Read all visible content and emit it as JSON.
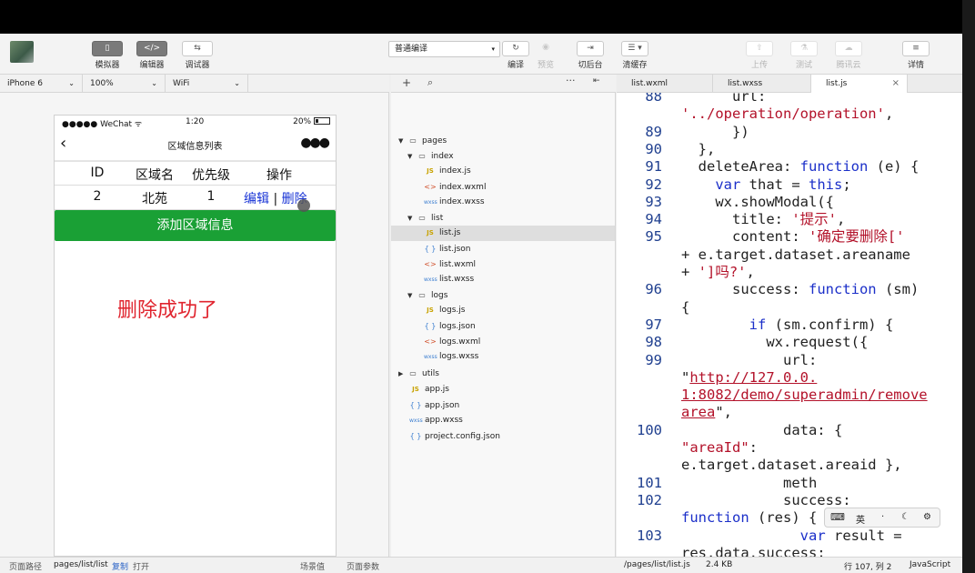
{
  "toolbar": {
    "simulator": "模拟器",
    "editor": "编辑器",
    "debugger": "调试器",
    "compile_mode": "普通编译",
    "compile": "编译",
    "preview": "预览",
    "background": "切后台",
    "clear_cache": "清缓存",
    "upload": "上传",
    "test": "测试",
    "tencent_cloud": "腾讯云",
    "details": "详情"
  },
  "device_bar": {
    "device": "iPhone 6",
    "zoom": "100%",
    "network": "WiFi"
  },
  "phone": {
    "carrier": "●●●●● WeChat ᯤ",
    "time": "1:20",
    "battery": "20%",
    "title": "区域信息列表",
    "table": {
      "headers": [
        "ID",
        "区域名",
        "优先级",
        "操作"
      ],
      "row": {
        "id": "2",
        "name": "北苑",
        "priority": "1",
        "edit": "编辑",
        "sep": "|",
        "delete": "删除"
      }
    },
    "add_button": "添加区域信息",
    "success_text": "删除成功了"
  },
  "bottom": {
    "path_label": "页面路径",
    "path": "pages/list/list",
    "copy": "复制",
    "open": "打开",
    "scene": "场景值",
    "params": "页面参数",
    "file_path": "/pages/list/list.js",
    "file_size": "2.4 KB",
    "cursor_pos": "行 107, 列 2",
    "lang": "JavaScript"
  },
  "tree": {
    "pages": "pages",
    "index": "index",
    "index_js": "index.js",
    "index_wxml": "index.wxml",
    "index_wxss": "index.wxss",
    "list": "list",
    "list_js": "list.js",
    "list_json": "list.json",
    "list_wxml": "list.wxml",
    "list_wxss": "list.wxss",
    "logs": "logs",
    "logs_js": "logs.js",
    "logs_json": "logs.json",
    "logs_wxml": "logs.wxml",
    "logs_wxss": "logs.wxss",
    "utils": "utils",
    "app_js": "app.js",
    "app_json": "app.json",
    "app_wxss": "app.wxss",
    "project_config": "project.config.json",
    "icon_js": "JS",
    "icon_json": "{ }",
    "icon_wxml": "<>",
    "icon_wxss": "wxss"
  },
  "tabs": [
    "list.wxml",
    "list.wxss",
    "list.js"
  ],
  "code": {
    "lines": [
      {
        "n": "88",
        "t": "      url:"
      },
      {
        "n": "",
        "t": "'../operation/operation',"
      },
      {
        "n": "89",
        "t": "      })"
      },
      {
        "n": "90",
        "t": "  },"
      },
      {
        "n": "91",
        "t": "  deleteArea: function (e) {"
      },
      {
        "n": "92",
        "t": "    var that = this;"
      },
      {
        "n": "93",
        "t": "    wx.showModal({"
      },
      {
        "n": "94",
        "t": "      title: '提示',"
      },
      {
        "n": "95",
        "t": "      content: '确定要删除['"
      },
      {
        "n": "",
        "t": "+ e.target.dataset.areaname"
      },
      {
        "n": "",
        "t": "+ ']吗?',"
      },
      {
        "n": "96",
        "t": "      success: function (sm)"
      },
      {
        "n": "",
        "t": "{"
      },
      {
        "n": "97",
        "t": "        if (sm.confirm) {"
      },
      {
        "n": "98",
        "t": "          wx.request({"
      },
      {
        "n": "99",
        "t": "            url:"
      },
      {
        "n": "",
        "t": "\"http://127.0.0."
      },
      {
        "n": "",
        "t": "1:8082/demo/superadmin/remove"
      },
      {
        "n": "",
        "t": "area\","
      },
      {
        "n": "100",
        "t": "            data: {"
      },
      {
        "n": "",
        "t": "\"areaId\":"
      },
      {
        "n": "",
        "t": "e.target.dataset.areaid },"
      },
      {
        "n": "101",
        "t": "            meth"
      },
      {
        "n": "102",
        "t": "            success:"
      },
      {
        "n": "",
        "t": "function (res) {"
      },
      {
        "n": "103",
        "t": "              var result ="
      },
      {
        "n": "",
        "t": "res.data.success;"
      }
    ]
  },
  "ime": {
    "lang": "英",
    "dot": "·"
  }
}
